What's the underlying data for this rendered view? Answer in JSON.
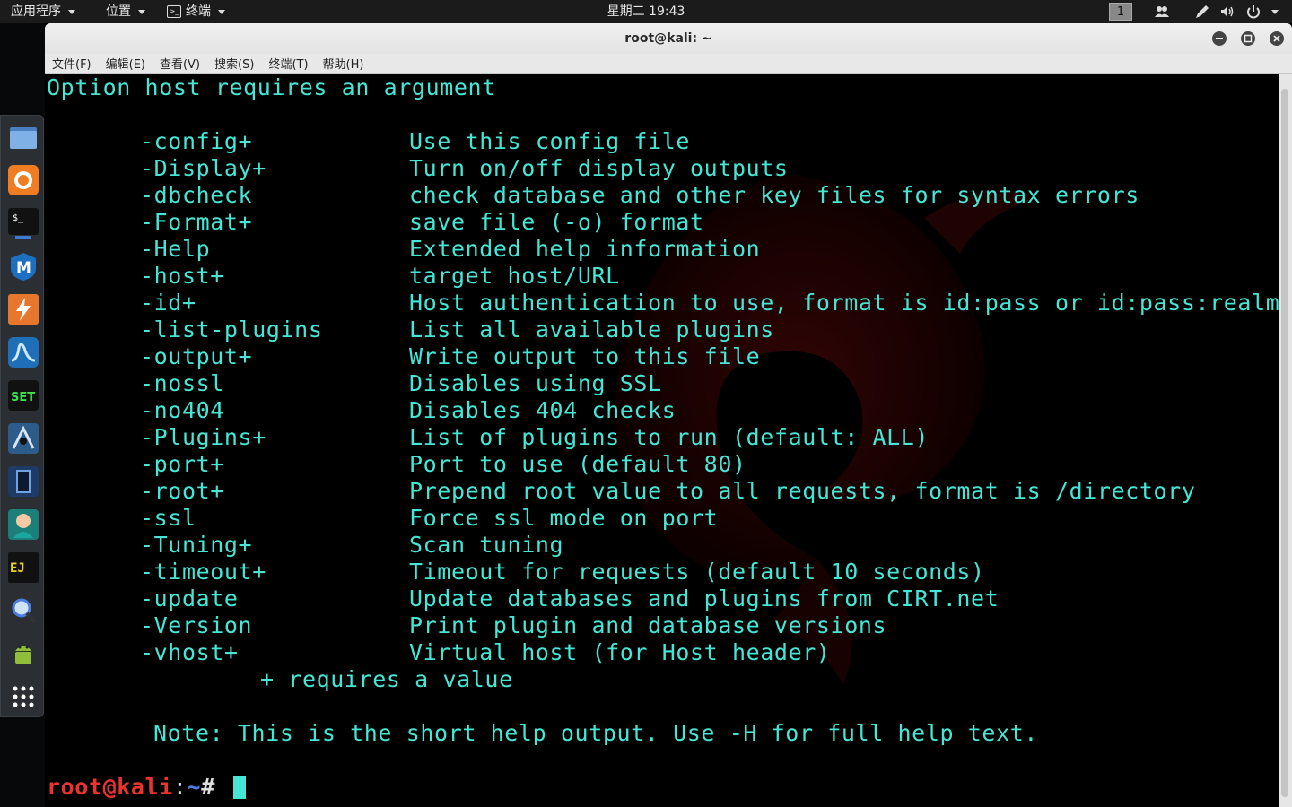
{
  "topbar": {
    "apps_label": "应用程序",
    "places_label": "位置",
    "terminal_label": "终端",
    "clock": "星期二 19:43",
    "workspace": "1"
  },
  "dock": {
    "items": [
      "files-icon",
      "firefox-icon",
      "terminal-icon",
      "metasploit-icon",
      "burpsuite-icon",
      "wireshark-icon",
      "set-icon",
      "armitage-icon",
      "beef-icon",
      "maltego-icon",
      "faraday-icon",
      "searchsploit-icon",
      "android-icon",
      "show-apps-icon"
    ]
  },
  "window": {
    "title": "root@kali: ~",
    "menu": [
      "文件(F)",
      "编辑(E)",
      "查看(V)",
      "搜索(S)",
      "终端(T)",
      "帮助(H)"
    ]
  },
  "terminal": {
    "header": "Option host requires an argument",
    "options": [
      {
        "opt": "-config+",
        "desc": "Use this config file"
      },
      {
        "opt": "-Display+",
        "desc": "Turn on/off display outputs"
      },
      {
        "opt": "-dbcheck",
        "desc": "check database and other key files for syntax errors"
      },
      {
        "opt": "-Format+",
        "desc": "save file (-o) format"
      },
      {
        "opt": "-Help",
        "desc": "Extended help information"
      },
      {
        "opt": "-host+",
        "desc": "target host/URL"
      },
      {
        "opt": "-id+",
        "desc": "Host authentication to use, format is id:pass or id:pass:realm"
      },
      {
        "opt": "-list-plugins",
        "desc": "List all available plugins"
      },
      {
        "opt": "-output+",
        "desc": "Write output to this file"
      },
      {
        "opt": "-nossl",
        "desc": "Disables using SSL"
      },
      {
        "opt": "-no404",
        "desc": "Disables 404 checks"
      },
      {
        "opt": "-Plugins+",
        "desc": "List of plugins to run (default: ALL)"
      },
      {
        "opt": "-port+",
        "desc": "Port to use (default 80)"
      },
      {
        "opt": "-root+",
        "desc": "Prepend root value to all requests, format is /directory"
      },
      {
        "opt": "-ssl",
        "desc": "Force ssl mode on port"
      },
      {
        "opt": "-Tuning+",
        "desc": "Scan tuning"
      },
      {
        "opt": "-timeout+",
        "desc": "Timeout for requests (default 10 seconds)"
      },
      {
        "opt": "-update",
        "desc": "Update databases and plugins from CIRT.net"
      },
      {
        "opt": "-Version",
        "desc": "Print plugin and database versions"
      },
      {
        "opt": "-vhost+",
        "desc": "Virtual host (for Host header)"
      }
    ],
    "requires_note": "+ requires a value",
    "short_help_note": "Note: This is the short help output. Use -H for full help text.",
    "prompt_user": "root@kali",
    "prompt_sep": ":",
    "prompt_path": "~",
    "prompt_symbol": "# "
  },
  "colors": {
    "terminal_text": "#45e6d5",
    "prompt_user": "#e8332f",
    "prompt_path": "#4a7ee0"
  }
}
